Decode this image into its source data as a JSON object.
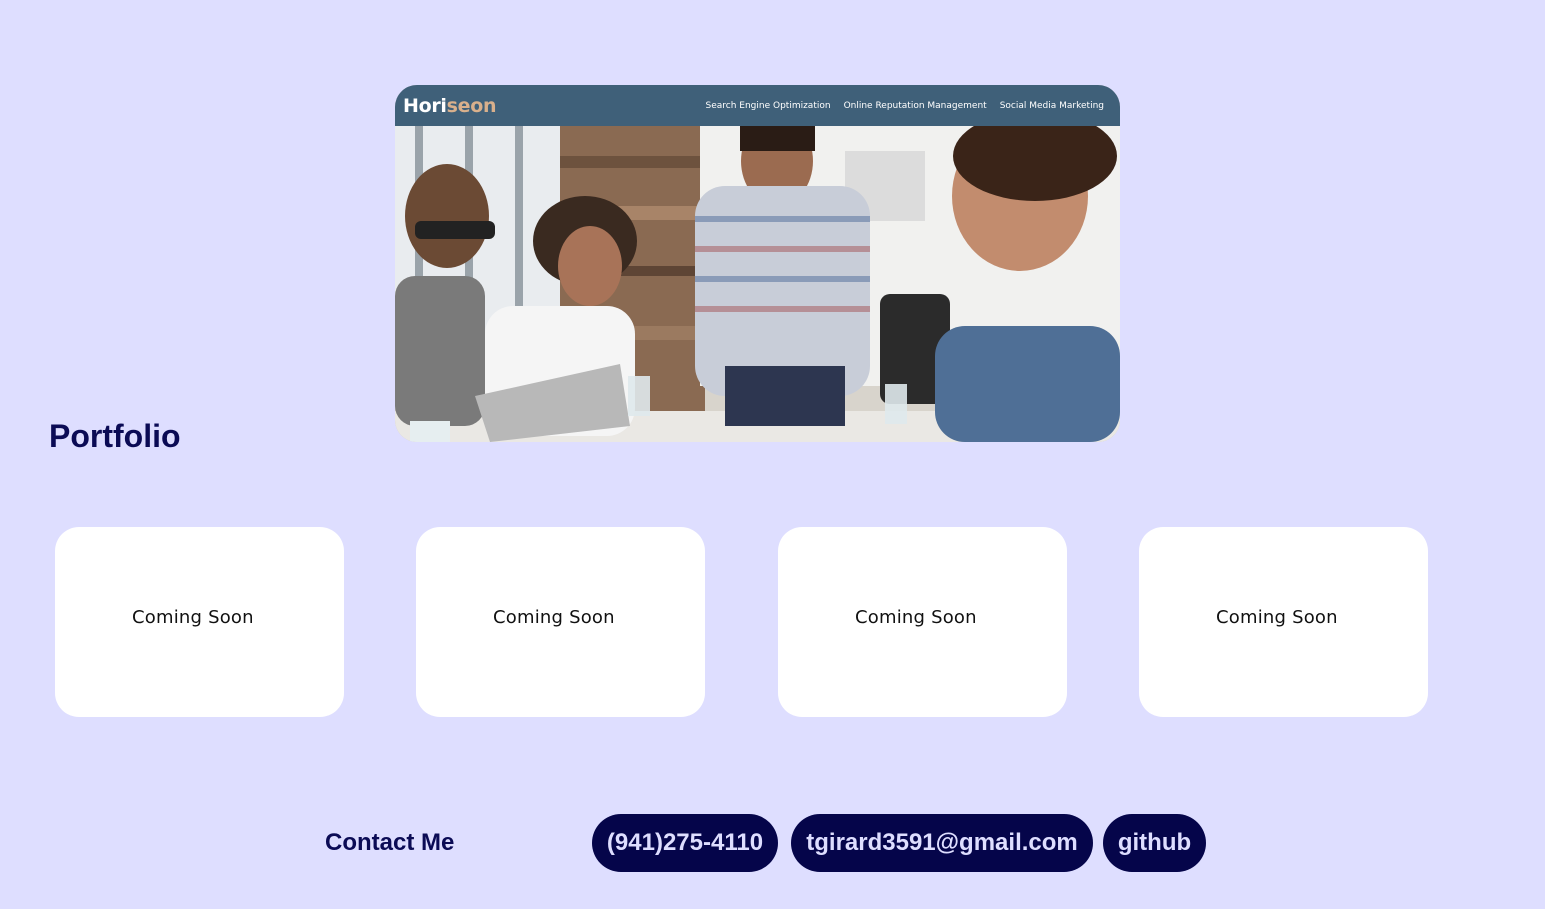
{
  "portfolio": {
    "title": "Portfolio"
  },
  "featured_project": {
    "logo_main": "Hori",
    "logo_accent": "seon",
    "nav_links": [
      "Search Engine Optimization",
      "Online Reputation Management",
      "Social Media Marketing"
    ],
    "image_description_icon": "team-meeting-photo"
  },
  "projects": [
    {
      "label": "Coming Soon"
    },
    {
      "label": "Coming Soon"
    },
    {
      "label": "Coming Soon"
    },
    {
      "label": "Coming Soon"
    }
  ],
  "contact": {
    "title": "Contact Me",
    "phone": "(941)275-4110",
    "email": "tgirard3591@gmail.com",
    "github": "github"
  },
  "colors": {
    "background": "#dedeff",
    "heading": "#0b0b55",
    "pill_bg": "#05054a",
    "pill_text": "#dedeff",
    "hero_nav": "#3f6079"
  }
}
